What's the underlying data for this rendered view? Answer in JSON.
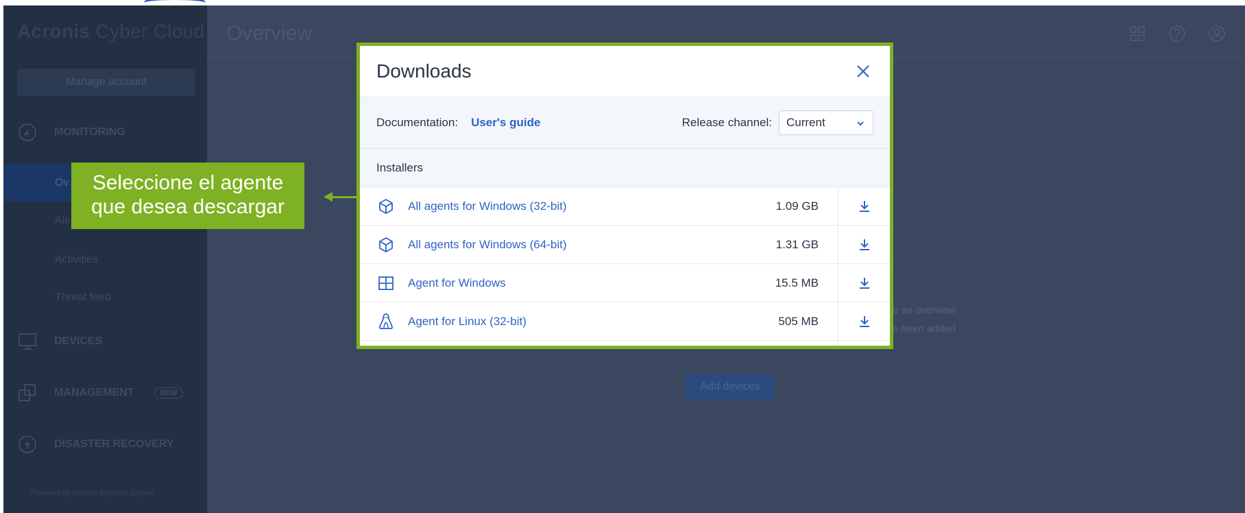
{
  "app": {
    "brand_bold": "Acronis",
    "brand_light": " Cyber Cloud",
    "manage_account": "Manage account",
    "powered_by": "Powered by Acronis AnyData Engine"
  },
  "sidebar": {
    "sections": [
      {
        "label": "MONITORING",
        "icon": "gauge-icon"
      },
      {
        "label": "DEVICES",
        "icon": "monitor-icon"
      },
      {
        "label": "MANAGEMENT",
        "icon": "management-icon",
        "badge": "NEW"
      },
      {
        "label": "DISASTER RECOVERY",
        "icon": "lightning-icon"
      }
    ],
    "monitoring_items": [
      "Ov",
      "Ale",
      "Activities",
      "Threat feed"
    ]
  },
  "header": {
    "title": "Overview",
    "icons": [
      "grid-icon",
      "help-icon",
      "account-icon"
    ]
  },
  "background": {
    "text_line1": "e an overview",
    "text_line2": "e been added",
    "add_devices": "Add devices"
  },
  "modal": {
    "title": "Downloads",
    "documentation_label": "Documentation:",
    "documentation_link": "User's guide",
    "release_channel_label": "Release channel:",
    "release_channel_value": "Current",
    "installers_label": "Installers",
    "rows": [
      {
        "name": "All agents for Windows (32-bit)",
        "size": "1.09 GB",
        "icon": "package-icon"
      },
      {
        "name": "All agents for Windows (64-bit)",
        "size": "1.31 GB",
        "icon": "package-icon"
      },
      {
        "name": "Agent for Windows",
        "size": "15.5 MB",
        "icon": "windows-icon"
      },
      {
        "name": "Agent for Linux (32-bit)",
        "size": "505 MB",
        "icon": "linux-icon"
      }
    ]
  },
  "callout": {
    "line1": "Seleccione el agente",
    "line2": "que desea descargar"
  },
  "colors": {
    "accent_green": "#7fb124",
    "link_blue": "#2f63c6",
    "overlay_bg": "#3a475e",
    "sidebar_bg": "#232f43"
  }
}
